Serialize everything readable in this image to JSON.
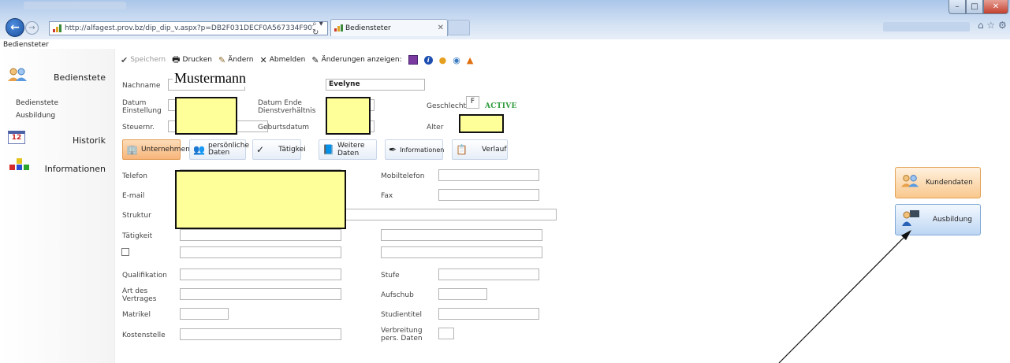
{
  "browser": {
    "url": "http://alfagest.prov.bz/dip_dip_v.aspx?p=DB2F031DECF0A567334F90",
    "tab_title": "Bediensteter",
    "search_icon": "magnifier-refresh-icon",
    "right_icons": "⌂ ☆ ⚙"
  },
  "page": {
    "title": "Bediensteter"
  },
  "sidebar": {
    "sections": [
      {
        "label": "Bedienstete",
        "icon": "people-icon"
      },
      {
        "label": "Historik",
        "icon": "calendar-icon"
      },
      {
        "label": "Informationen",
        "icon": "blocks-icon"
      }
    ],
    "links": [
      "Bedienstete",
      "Ausbildung"
    ]
  },
  "toolbar": {
    "speichern": "Speichern",
    "drucken": "Drucken",
    "aendern": "Ändern",
    "abmelden": "Abmelden",
    "aenderungen": "Änderungen anzeigen:"
  },
  "person": {
    "nachname_label": "Nachname",
    "nachname_value": "Mustermann",
    "vorname_value": "Evelyne",
    "datum_einstellung_label": "Datum Einstellung",
    "datum_ende_label": "Datum Ende Dienstverhältnis",
    "geschlecht_label": "Geschlecht",
    "geschlecht_value": "F",
    "status": "ACTIVE",
    "steuernr_label": "Steuernr.",
    "geburtsdatum_label": "Geburtsdatum",
    "alter_label": "Alter"
  },
  "tabs": [
    "Unternehmen",
    "persönliche Daten",
    "Tätigkei",
    "Weitere Daten",
    "Informationen",
    "Verlauf"
  ],
  "fields": {
    "telefon": "Telefon",
    "email": "E-mail",
    "struktur": "Struktur",
    "taetigkeit": "Tätigkeit",
    "qualifikation": "Qualifikation",
    "art_vertrag": "Art des Vertrages",
    "matrikel": "Matrikel",
    "kostenstelle": "Kostenstelle",
    "mobiltelefon": "Mobiltelefon",
    "fax": "Fax",
    "stufe": "Stufe",
    "aufschub": "Aufschub",
    "studientitel": "Studientitel",
    "verbreitung": "Verbreitung pers. Daten"
  },
  "right_buttons": {
    "kundendaten": "Kundendaten",
    "ausbildung": "Ausbildung"
  },
  "colors": {
    "highlight": "#ffff99",
    "active_status": "#2e9a3a",
    "active_tab": "#f7b57a",
    "ausbildung_button": "#bdd6f2"
  }
}
